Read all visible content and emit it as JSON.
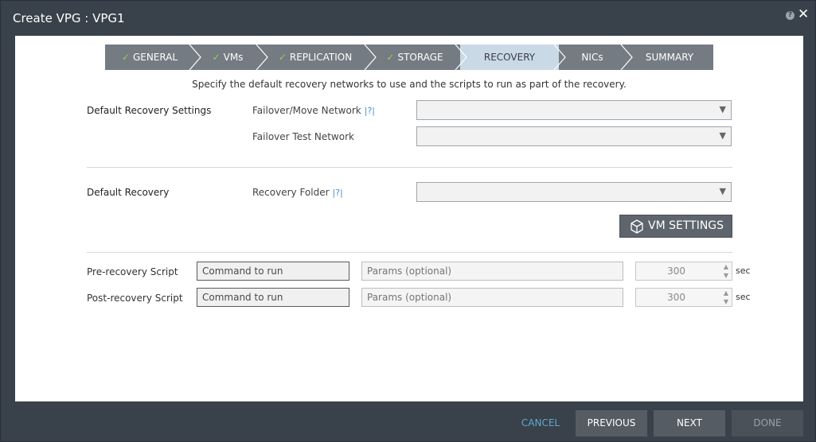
{
  "window": {
    "title": "Create VPG : VPG1"
  },
  "wizard": {
    "steps": [
      {
        "label": "GENERAL",
        "done": true
      },
      {
        "label": "VMs",
        "done": true
      },
      {
        "label": "REPLICATION",
        "done": true
      },
      {
        "label": "STORAGE",
        "done": true
      },
      {
        "label": "RECOVERY",
        "done": false,
        "active": true
      },
      {
        "label": "NICs",
        "done": false
      },
      {
        "label": "SUMMARY",
        "done": false
      }
    ],
    "check_glyph": "✓"
  },
  "instruction": "Specify the default recovery networks to use and the scripts to run as part of the recovery.",
  "default_recovery_settings": {
    "section_label": "Default Recovery Settings",
    "failover_network_label": "Failover/Move Network",
    "failover_network_value": "",
    "failover_test_label": "Failover Test Network",
    "failover_test_value": ""
  },
  "default_recovery": {
    "section_label": "Default Recovery",
    "folder_label": "Recovery Folder",
    "folder_value": ""
  },
  "help_glyph": "|?|",
  "vm_settings_label": "VM SETTINGS",
  "scripts": {
    "pre": {
      "label": "Pre-recovery Script",
      "command_value": "Command to run",
      "params_placeholder": "Params (optional)",
      "timeout": "300"
    },
    "post": {
      "label": "Post-recovery Script",
      "command_value": "Command to run",
      "params_placeholder": "Params (optional)",
      "timeout": "300"
    },
    "unit": "sec"
  },
  "footer": {
    "cancel_label": "CANCEL",
    "previous_label": "PREVIOUS",
    "next_label": "NEXT",
    "done_label": "DONE"
  },
  "colors": {
    "accent_check": "#8fd14f",
    "active_step": "#c9d9e6",
    "step_bg": "#747b83",
    "cancel_link": "#62a8cc"
  }
}
